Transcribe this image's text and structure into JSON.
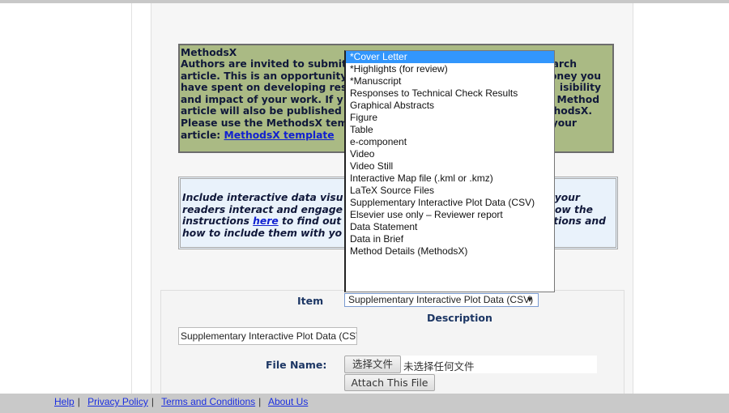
{
  "methodsx_box": {
    "title": "MethodsX",
    "lines_left": [
      "Authors are invited to submit",
      "article. This is an opportunity",
      "have spent on developing res",
      "and impact of your work. If y",
      "article will also be published",
      "Please use the MethodsX tem",
      "article: "
    ],
    "lines_right": [
      "arch",
      "oney you",
      "isibility",
      "Method",
      "hodsX.",
      "your"
    ],
    "link": "MethodsX template"
  },
  "interactive_box": {
    "lines_left": [
      "Include interactive data visu",
      "readers interact and engage",
      "instructions ",
      "how to include them with yo"
    ],
    "line3_link": "here",
    "line3_after": " to find out",
    "lines_right": [
      "your",
      "ow the",
      "tions and"
    ]
  },
  "dropdown": {
    "options": [
      "*Cover Letter",
      "*Highlights (for review)",
      "*Manuscript",
      "Responses to Technical Check Results",
      "Graphical Abstracts",
      "Figure",
      "Table",
      "e-component",
      "Video",
      "Video Still",
      "Interactive Map file (.kml or .kmz)",
      "LaTeX Source Files",
      "Supplementary Interactive Plot Data (CSV)",
      "Elsevier use only – Reviewer report",
      "Data Statement",
      "Data in Brief",
      "Method Details (MethodsX)"
    ],
    "highlighted": "*Cover Letter"
  },
  "form": {
    "item_label": "Item",
    "item_value": "Supplementary Interactive Plot Data (CSV)",
    "description_label": "Description",
    "description_value": "Supplementary Interactive Plot Data (CSV)",
    "file_name_label": "File Name:",
    "choose_file": "选择文件",
    "no_file": "未选择任何文件",
    "attach": "Attach This File"
  },
  "footer": {
    "help": "Help",
    "privacy": "Privacy Policy",
    "terms": "Terms and Conditions",
    "about": "About Us",
    "sep": "|"
  }
}
